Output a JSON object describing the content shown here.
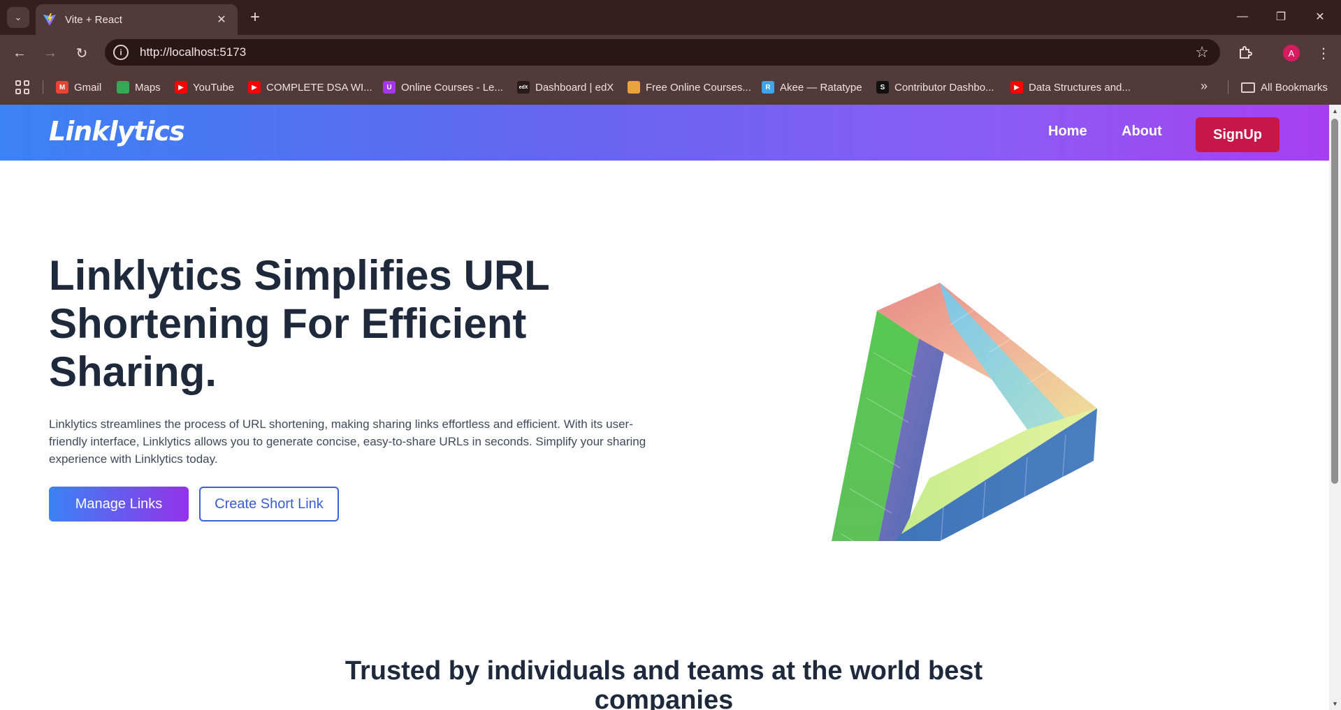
{
  "browser": {
    "tab": {
      "title": "Vite + React"
    },
    "url": "http://localhost:5173",
    "avatar_letter": "A",
    "bookmarks": [
      {
        "label": "Gmail",
        "icon": "gmail-icon",
        "color": "#ea4335"
      },
      {
        "label": "Maps",
        "icon": "maps-icon",
        "color": "#34a853"
      },
      {
        "label": "YouTube",
        "icon": "youtube-icon",
        "color": "#ff0000"
      },
      {
        "label": "COMPLETE DSA WI...",
        "icon": "youtube-icon",
        "color": "#ff0000"
      },
      {
        "label": "Online Courses - Le...",
        "icon": "udemy-icon",
        "color": "#a435f0"
      },
      {
        "label": "Dashboard | edX",
        "icon": "edx-icon",
        "color": "#2a1b1b"
      },
      {
        "label": "Free Online Courses...",
        "icon": "coursera-icon",
        "color": "#e8a33d"
      },
      {
        "label": "Akee — Ratatype",
        "icon": "ratatype-icon",
        "color": "#3aa7f0"
      },
      {
        "label": "Contributor Dashbo...",
        "icon": "contributor-icon",
        "color": "#111111"
      },
      {
        "label": "Data Structures and...",
        "icon": "youtube-icon",
        "color": "#ff0000"
      }
    ],
    "all_bookmarks": "All Bookmarks"
  },
  "page": {
    "navbar": {
      "brand": "Linklytics",
      "links": [
        "Home",
        "About"
      ],
      "signup": "SignUp"
    },
    "hero": {
      "title": "Linklytics Simplifies URL Shortening For Efficient Sharing.",
      "description": "Linklytics streamlines the process of URL shortening, making sharing links effortless and efficient. With its user-friendly interface, Linklytics allows you to generate concise, easy-to-share URLs in seconds. Simplify your sharing experience with Linklytics today.",
      "primary_button": "Manage Links",
      "secondary_button": "Create Short Link"
    },
    "trusted": "Trusted by individuals and teams at the world best companies"
  },
  "colors": {
    "navbar_gradient_start": "#3b82f6",
    "navbar_gradient_end": "#a63ff0",
    "signup_bg": "#c8154a",
    "heading": "#1e293b"
  }
}
